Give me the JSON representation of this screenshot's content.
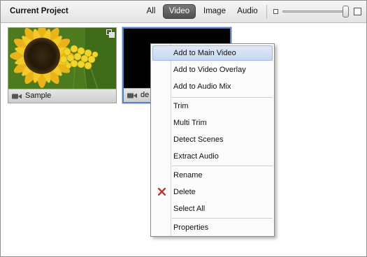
{
  "header": {
    "title": "Current Project",
    "filters": [
      "All",
      "Video",
      "Image",
      "Audio"
    ],
    "active_filter": "Video",
    "zoom_icons": {
      "min": "zoom-small-square-icon",
      "max": "zoom-large-square-icon"
    }
  },
  "media_items": [
    {
      "label": "Sample",
      "type_icon": "video-camera-icon",
      "badge_icon": "overlap-squares-icon"
    },
    {
      "label": "de",
      "type_icon": "video-camera-icon"
    }
  ],
  "context_menu": {
    "groups": [
      [
        "Add to Main Video",
        "Add to Video Overlay",
        "Add to Audio Mix"
      ],
      [
        "Trim",
        "Multi Trim",
        "Detect Scenes",
        "Extract Audio"
      ],
      [
        "Rename",
        "Delete",
        "Select All"
      ],
      [
        "Properties"
      ]
    ],
    "highlighted": "Add to Main Video",
    "delete_icon": "red-x-icon"
  },
  "colors": {
    "active_filter_bg": "#5c5c5c",
    "selected_border": "#5a82b8",
    "menu_highlight": "#c6d8ef",
    "delete_icon": "#b03a3a"
  }
}
